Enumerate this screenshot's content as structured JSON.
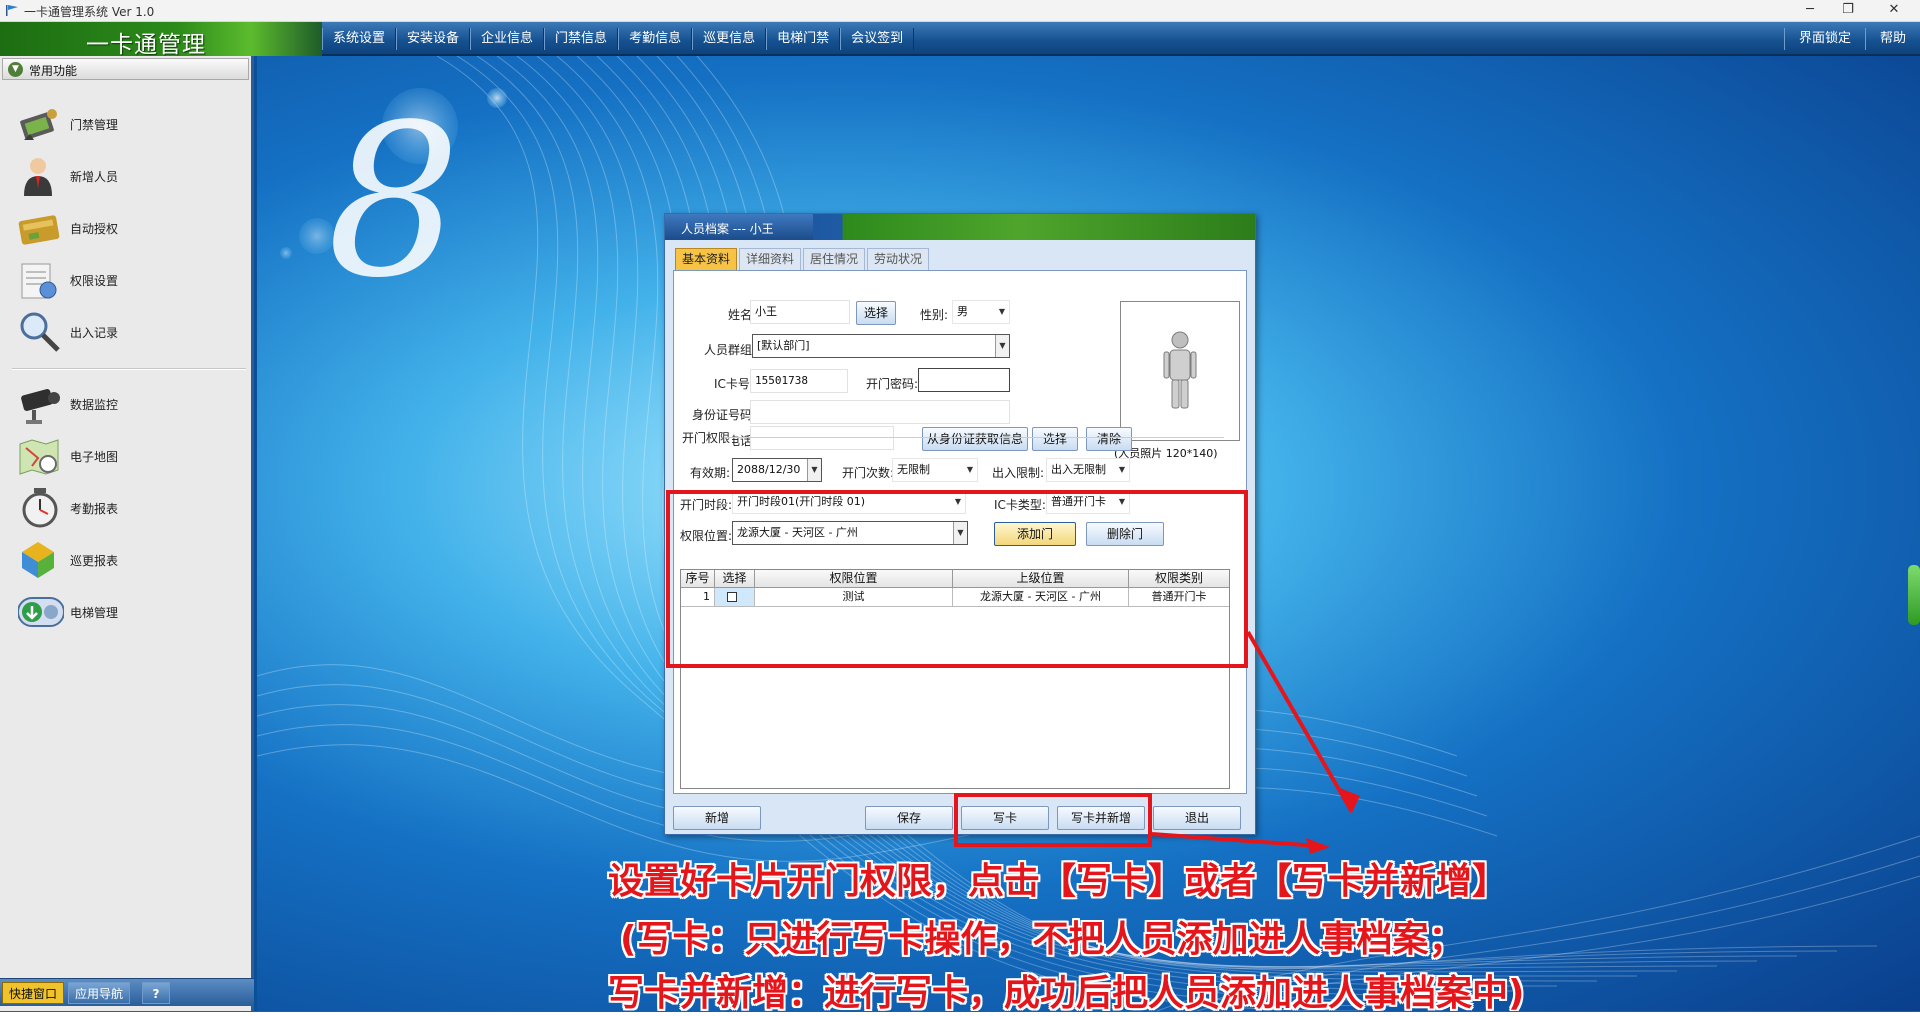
{
  "window": {
    "title": "一卡通管理系统 Ver 1.0",
    "minimize": "─",
    "restore": "❐",
    "close": "✕"
  },
  "menubar": {
    "brand": "一卡通管理",
    "items": [
      "系统设置",
      "安装设备",
      "企业信息",
      "门禁信息",
      "考勤信息",
      "巡更信息",
      "电梯门禁",
      "会议签到"
    ],
    "right_items": [
      "界面锁定",
      "帮助"
    ]
  },
  "sidebar": {
    "header": "常用功能",
    "toggle": "▼",
    "items": [
      {
        "label": "门禁管理",
        "icon": "door-access-icon"
      },
      {
        "label": "新增人员",
        "icon": "person-add-icon"
      },
      {
        "label": "自动授权",
        "icon": "card-authorize-icon"
      },
      {
        "label": "权限设置",
        "icon": "permission-doc-icon"
      },
      {
        "label": "出入记录",
        "icon": "magnifier-icon"
      },
      {
        "label": "数据监控",
        "icon": "camera-monitor-icon"
      },
      {
        "label": "电子地图",
        "icon": "map-icon"
      },
      {
        "label": "考勤报表",
        "icon": "clock-report-icon"
      },
      {
        "label": "巡更报表",
        "icon": "patrol-report-icon"
      },
      {
        "label": "电梯管理",
        "icon": "elevator-icon"
      }
    ],
    "tabs": {
      "quick": "快捷窗口",
      "nav": "应用导航",
      "help": "?"
    }
  },
  "dialog": {
    "title": "人员档案 --- 小王",
    "tabs": [
      "基本资料",
      "详细资料",
      "居住情况",
      "劳动状况"
    ],
    "form": {
      "name_label": "姓名:",
      "name_value": "小王",
      "select_button": "选择",
      "gender_label": "性别:",
      "gender_value": "男",
      "group_label": "人员群组:",
      "group_value": "[默认部门]",
      "ic_label": "IC卡号:",
      "ic_value": "15501738",
      "door_pwd_label": "开门密码:",
      "door_pwd_value": "",
      "id_label": "身份证号码:",
      "id_value": "",
      "phone_label": "联系电话:",
      "phone_value": "",
      "id_fetch_button": "从身份证获取信息",
      "photo_select_button": "选择",
      "photo_clear_button": "清除",
      "photo_caption": "(人员照片 120*140)"
    },
    "access": {
      "group_title": "开门权限",
      "valid_label": "有效期:",
      "valid_value": "2088/12/30",
      "open_count_label": "开门次数:",
      "open_count_value": "无限制",
      "inout_label": "出入限制:",
      "inout_value": "出入无限制",
      "period_label": "开门时段:",
      "period_value": "开门时段01(开门时段 01)",
      "card_type_label": "IC卡类型:",
      "card_type_value": "普通开门卡",
      "location_label": "权限位置:",
      "location_value": "龙源大厦 - 天河区 - 广州",
      "add_door_button": "添加门",
      "delete_door_button": "删除门",
      "table": {
        "headers": [
          "序号",
          "选择",
          "权限位置",
          "上级位置",
          "权限类别"
        ],
        "rows": [
          {
            "index": "1",
            "location": "测试",
            "parent": "龙源大厦 - 天河区 - 广州",
            "category": "普通开门卡"
          }
        ]
      }
    },
    "buttons": {
      "new": "新增",
      "save": "保存",
      "write": "写卡",
      "write_new": "写卡并新增",
      "exit": "退出"
    }
  },
  "annotation": {
    "line1": "设置好卡片开门权限，点击【写卡】或者【写卡并新增】",
    "line2": "(写卡：只进行写卡操作，不把人员添加进人事档案；",
    "line3": "写卡并新增：进行写卡，成功后把人员添加进人事档案中)",
    "color": "#e4161c"
  },
  "decor": {
    "logo_digit": "8"
  }
}
